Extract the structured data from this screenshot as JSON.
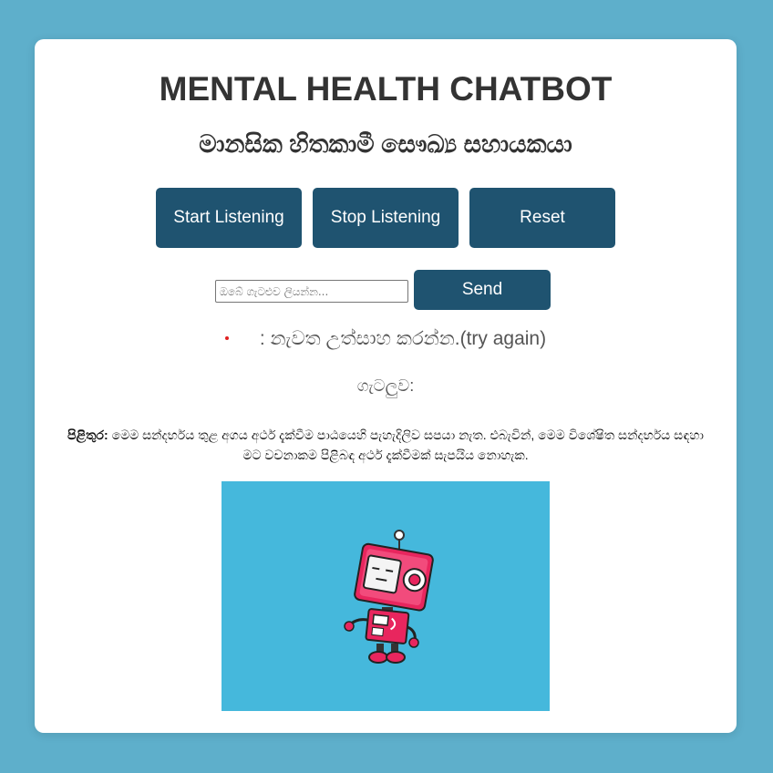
{
  "header": {
    "title": "MENTAL HEALTH CHATBOT",
    "subtitle": "මානසික හිතකාමී සෞඛ්‍ය සහායකයා"
  },
  "controls": {
    "start_label": "Start Listening",
    "stop_label": "Stop Listening",
    "reset_label": "Reset"
  },
  "chat": {
    "input_placeholder": "ඔබේ ගැටළුව ලියන්න...",
    "input_value": "",
    "send_label": "Send"
  },
  "status": {
    "message": ": නැවත උත්සාහ කරන්න.(try again)"
  },
  "problem": {
    "label": "ගැටලුව:"
  },
  "response": {
    "prefix": "පිළිතුර:",
    "text": "මෙම සන්දර්භය තුළ අගය අර්ථ දැක්වීම පාඨයෙහි පැහැදිලිව සපයා නැත. එබැවින්, මෙම විශේෂිත සන්දර්භය සඳහා මට වචනාකම පිළිබඳ අර්ථ දැක්වීමක් සැපයිය නොහැක."
  },
  "colors": {
    "page_background": "#5eafcb",
    "button": "#1f5370",
    "robot_background": "#45b8dc",
    "robot_body": "#e8265e",
    "status_dot": "#e02020"
  },
  "icons": {
    "robot": "robot-mascot"
  }
}
